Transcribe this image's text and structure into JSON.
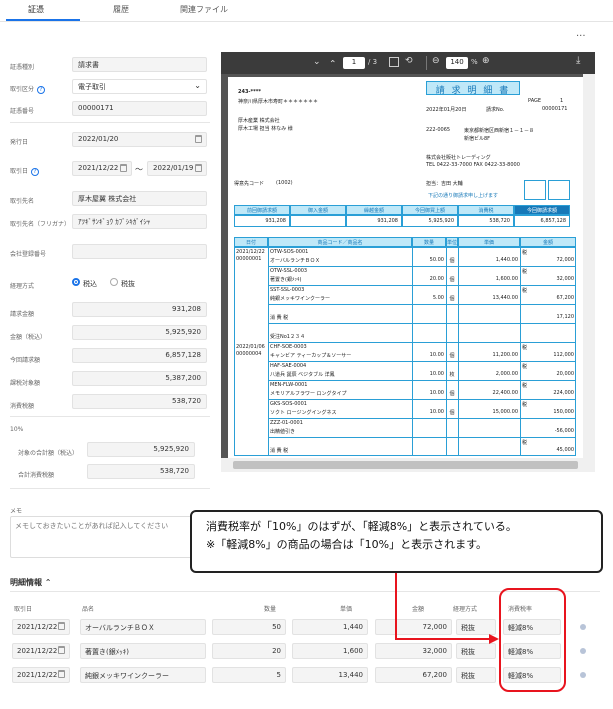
{
  "tabs": [
    "証憑",
    "履歴",
    "関連ファイル"
  ],
  "more_label": "...",
  "form": {
    "doc_type": {
      "label": "証憑種別",
      "value": "請求書"
    },
    "transaction_type": {
      "label": "取引区分",
      "value": "電子取引"
    },
    "doc_number": {
      "label": "証憑番号",
      "value": "00000171"
    },
    "issue_date": {
      "label": "発行日",
      "value": "2022/01/20"
    },
    "transaction_date": {
      "label": "取引日",
      "from": "2021/12/22",
      "tilde": "～",
      "to": "2022/01/19"
    },
    "partner_name": {
      "label": "取引先名",
      "value": "厚木屋翼 株式会社"
    },
    "partner_kana": {
      "label": "取引先名（フリガナ）",
      "value": "ｱﾂｷﾞｻﾝｷﾞｮｳ ｶﾌﾞｼｷｶﾞｲｼｬ"
    },
    "registration_no": {
      "label": "会社登録番号",
      "value": ""
    },
    "tax_method": {
      "label": "経理方式",
      "option1": "税込",
      "option2": "税抜"
    },
    "amount_total": {
      "label": "請求金額",
      "value": "931,208"
    },
    "amount_taxin": {
      "label": "金額（税込）",
      "value": "5,925,920"
    },
    "this_billing": {
      "label": "今回請求額",
      "value": "6,857,128"
    },
    "tax_base": {
      "label": "課税対象額",
      "value": "5,387,200"
    },
    "consumption_tax": {
      "label": "消費税額",
      "value": "538,720"
    },
    "rate_label": "10%",
    "rate_target": {
      "label": "対象の合計額（税込）",
      "value": "5,925,920"
    },
    "rate_tax": {
      "label": "合計消費税額",
      "value": "538,720"
    }
  },
  "viewer": {
    "page_current": "1",
    "page_total": "/ 3",
    "zoom": "140",
    "zoom_unit": "%"
  },
  "invoice": {
    "title": "請 求 明 細 書",
    "postal": "243-****",
    "address": "神奈川県厚木市寿町＊＊＊＊＊＊＊",
    "customer": "厚木産業 株式会社",
    "customer_dept": "厚木工場 担当 林なみ 様",
    "page_label": "PAGE",
    "page_no": "1",
    "date": "2022年01月20日",
    "doc_label": "請求No.",
    "doc_no": "00000171",
    "sender_postal": "222-0065",
    "sender_addr1": "東京都新宿区西新宿１－１－８",
    "sender_addr2": "新宿ビル8F",
    "sender_company": "株式会社販社トレーディング",
    "sender_tel": "TEL 0422-33-7000 FAX 0422-33-8000",
    "customer_code_label": "得意先コード",
    "customer_code": "(1002)",
    "staff": "担当：吉田 大輔",
    "note": "下記の通り御請求申し上げます",
    "summary_headers": [
      "前回御請求額",
      "御入金額",
      "繰越金額",
      "今回御買上額",
      "消費税",
      "今回御請求額"
    ],
    "summary_values": [
      "931,208",
      "",
      "931,208",
      "5,925,920",
      "538,720",
      "6,857,128"
    ],
    "table_headers": [
      "日付",
      "商品コード／商品名",
      "数量",
      "単位",
      "単価",
      "金額"
    ],
    "rows": [
      {
        "date": "2021/12/22",
        "slip": "00000001",
        "code": "OTW-SOS-0001",
        "name": "オーバルランチＢＯＸ",
        "qty": "50.00",
        "unit": "個",
        "price": "1,440.00",
        "amount": "72,000",
        "mark": "税"
      },
      {
        "date": "",
        "slip": "",
        "code": "OTW-SSL-0003",
        "name": "著置き(銀ﾒｯｷ)",
        "qty": "20.00",
        "unit": "個",
        "price": "1,600.00",
        "amount": "32,000",
        "mark": "税"
      },
      {
        "date": "",
        "slip": "",
        "code": "SST-SSL-0003",
        "name": "純銀メッキワインクーラー",
        "qty": "5.00",
        "unit": "個",
        "price": "13,440.00",
        "amount": "67,200",
        "mark": "税"
      },
      {
        "date": "",
        "slip": "",
        "code": "",
        "name": "消 費 税",
        "qty": "",
        "unit": "",
        "price": "",
        "amount": "17,120",
        "mark": ""
      },
      {
        "date": "",
        "slip": "",
        "code": "",
        "name": "受注No1２３４",
        "qty": "",
        "unit": "",
        "price": "",
        "amount": "",
        "mark": ""
      },
      {
        "date": "2022/01/06",
        "slip": "00000004",
        "code": "CHF-SOE-0003",
        "name": "キャンビア ティーカップ＆ソーサー",
        "qty": "10.00",
        "unit": "個",
        "price": "11,200.00",
        "amount": "112,000",
        "mark": "税"
      },
      {
        "date": "",
        "slip": "",
        "code": "HAF-SAE-0004",
        "name": "八道兵 誕辰 ベジタブル 洋鳳",
        "qty": "10.00",
        "unit": "枚",
        "price": "2,000.00",
        "amount": "20,000",
        "mark": "税"
      },
      {
        "date": "",
        "slip": "",
        "code": "MEN-FLW-0001",
        "name": "メモリアルフラワー ロングタイプ",
        "qty": "10.00",
        "unit": "個",
        "price": "22,400.00",
        "amount": "224,000",
        "mark": "税"
      },
      {
        "date": "",
        "slip": "",
        "code": "GKS-SOS-0001",
        "name": "ソクト ロージングイングネス",
        "qty": "10.00",
        "unit": "個",
        "price": "15,000.00",
        "amount": "150,000",
        "mark": "税"
      },
      {
        "date": "",
        "slip": "",
        "code": "ZZZ-01-0001",
        "name": "出精値引き",
        "qty": "",
        "unit": "",
        "price": "",
        "amount": "-56,000",
        "mark": ""
      },
      {
        "date": "",
        "slip": "",
        "code": "",
        "name": "消 費 税",
        "qty": "",
        "unit": "",
        "price": "",
        "amount": "45,000",
        "mark": "税"
      }
    ]
  },
  "memo": {
    "label": "メモ",
    "placeholder": "メモしておきたいことがあれば記入してください"
  },
  "callout": {
    "line1": "消費税率が「10%」のはずが、「軽減8%」と表示されている。",
    "line2": "※「軽減8%」の商品の場合は「10%」と表示されます。"
  },
  "details": {
    "title": "明細情報",
    "headers": [
      "取引日",
      "品名",
      "数量",
      "単価",
      "金額",
      "経理方式",
      "消費税率"
    ],
    "rows": [
      {
        "date": "2021/12/22",
        "name": "オーバルランチＢＯＸ",
        "qty": "50",
        "price": "1,440",
        "amount": "72,000",
        "method": "税抜",
        "rate": "軽減8%"
      },
      {
        "date": "2021/12/22",
        "name": "著置き(銀ﾒｯｷ)",
        "qty": "20",
        "price": "1,600",
        "amount": "32,000",
        "method": "税抜",
        "rate": "軽減8%"
      },
      {
        "date": "2021/12/22",
        "name": "純銀メッキワインクーラー",
        "qty": "5",
        "price": "13,440",
        "amount": "67,200",
        "method": "税抜",
        "rate": "軽減8%"
      }
    ]
  },
  "colors": {
    "accent": "#1a73e8",
    "highlight": "#e8141e",
    "invoice_blue": "#2a9fd6"
  }
}
